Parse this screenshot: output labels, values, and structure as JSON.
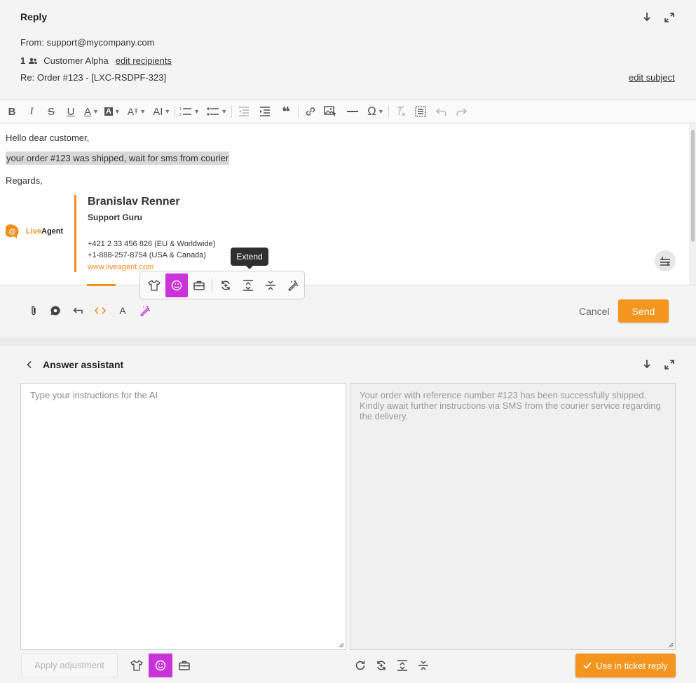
{
  "reply": {
    "title": "Reply",
    "from_label": "From:",
    "from_value": "support@mycompany.com",
    "recipient_count": "1",
    "recipient_name": "Customer Alpha",
    "edit_recipients": "edit recipients",
    "subject": "Re: Order #123 - [LXC-RSDPF-323]",
    "edit_subject": "edit subject"
  },
  "toolbar": {
    "bold": "B",
    "italic": "I",
    "strike": "S",
    "underline": "U",
    "font_color": "A",
    "bg_color": "A",
    "font_size": "A",
    "ai_label": "AI",
    "special_char": "Ω"
  },
  "editor": {
    "greeting": "Hello dear customer,",
    "body": "your order #123 was shipped, wait for sms from courier",
    "regards": "Regards,"
  },
  "signature": {
    "name": "Branislav Renner",
    "role": "Support Guru",
    "phone_eu": "+421 2 33 456 826 (EU & Worldwide)",
    "phone_us": "+1-888-257-8754 (USA & Canada)",
    "website": "www.liveagent.com",
    "logo_live": "Live",
    "logo_agent": "Agent"
  },
  "tooltip": {
    "text": "Extend"
  },
  "reply_actions": {
    "font_label": "A",
    "cancel": "Cancel",
    "send": "Send"
  },
  "assistant": {
    "title": "Answer assistant",
    "instructions_placeholder": "Type your instructions for the AI",
    "output": "Your order with reference number #123 has been successfully shipped. Kindly await further instructions via SMS from the courier service regarding the delivery.",
    "apply_adjustment": "Apply adjustment",
    "use_in_reply": "Use in ticket reply"
  },
  "colors": {
    "accent_orange": "#f4951f",
    "active_magenta": "#c933d9",
    "brand_orange": "#f28c1c"
  }
}
